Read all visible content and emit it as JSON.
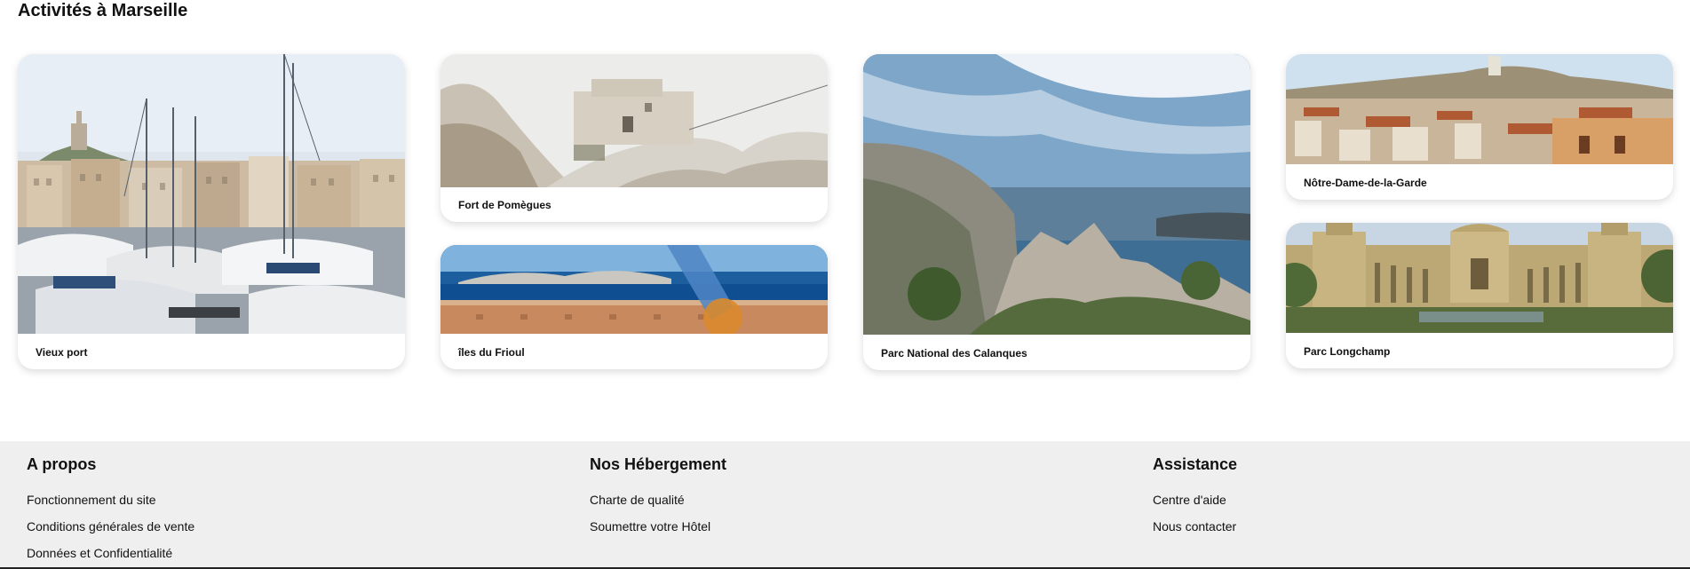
{
  "page": {
    "title": "Activités à Marseille"
  },
  "activities": [
    {
      "label": "Vieux port",
      "image": "vieux-port-harbour-photo"
    },
    {
      "label": "Fort de Pomègues",
      "image": "fort-pomegues-photo"
    },
    {
      "label": "îles du Frioul",
      "image": "iles-du-frioul-photo"
    },
    {
      "label": "Parc National des Calanques",
      "image": "calanques-photo"
    },
    {
      "label": "Nôtre-Dame-de-la-Garde",
      "image": "notre-dame-de-la-garde-photo"
    },
    {
      "label": "Parc Longchamp",
      "image": "parc-longchamp-photo"
    }
  ],
  "footer": {
    "about": {
      "title": "A propos",
      "links": [
        "Fonctionnement du site",
        "Conditions générales de vente",
        "Données et Confidentialité"
      ]
    },
    "lodging": {
      "title": "Nos Hébergement",
      "links": [
        "Charte de qualité",
        "Soumettre votre Hôtel"
      ]
    },
    "help": {
      "title": "Assistance",
      "links": [
        "Centre d'aide",
        "Nous contacter"
      ]
    }
  }
}
